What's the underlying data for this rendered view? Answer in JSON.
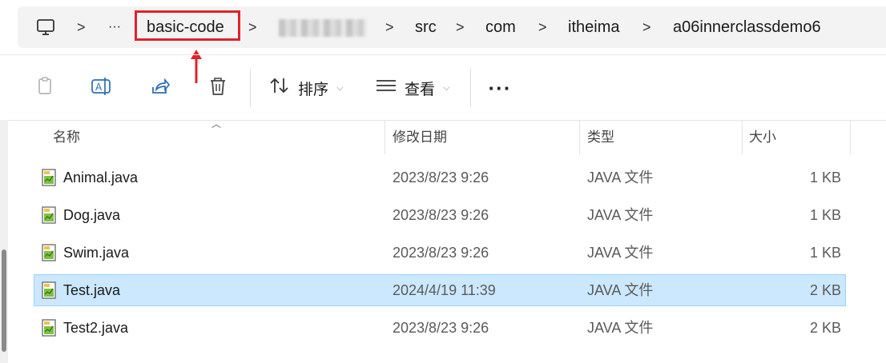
{
  "breadcrumb": {
    "items": [
      "basic-code",
      "src",
      "com",
      "itheima",
      "a06innerclassdemo6"
    ],
    "ellipsis": "···",
    "separator": ">"
  },
  "toolbar": {
    "sort_label": "排序",
    "view_label": "查看",
    "more_label": "···"
  },
  "columns": {
    "name": "名称",
    "date": "修改日期",
    "type": "类型",
    "size": "大小"
  },
  "files": [
    {
      "name": "Animal.java",
      "date": "2023/8/23 9:26",
      "type": "JAVA 文件",
      "size": "1 KB"
    },
    {
      "name": "Dog.java",
      "date": "2023/8/23 9:26",
      "type": "JAVA 文件",
      "size": "1 KB"
    },
    {
      "name": "Swim.java",
      "date": "2023/8/23 9:26",
      "type": "JAVA 文件",
      "size": "1 KB"
    },
    {
      "name": "Test.java",
      "date": "2024/4/19 11:39",
      "type": "JAVA 文件",
      "size": "2 KB",
      "selected": true
    },
    {
      "name": "Test2.java",
      "date": "2023/8/23 9:26",
      "type": "JAVA 文件",
      "size": "2 KB"
    }
  ],
  "colors": {
    "highlight_box": "#e0222a",
    "selection": "#cce8ff"
  }
}
